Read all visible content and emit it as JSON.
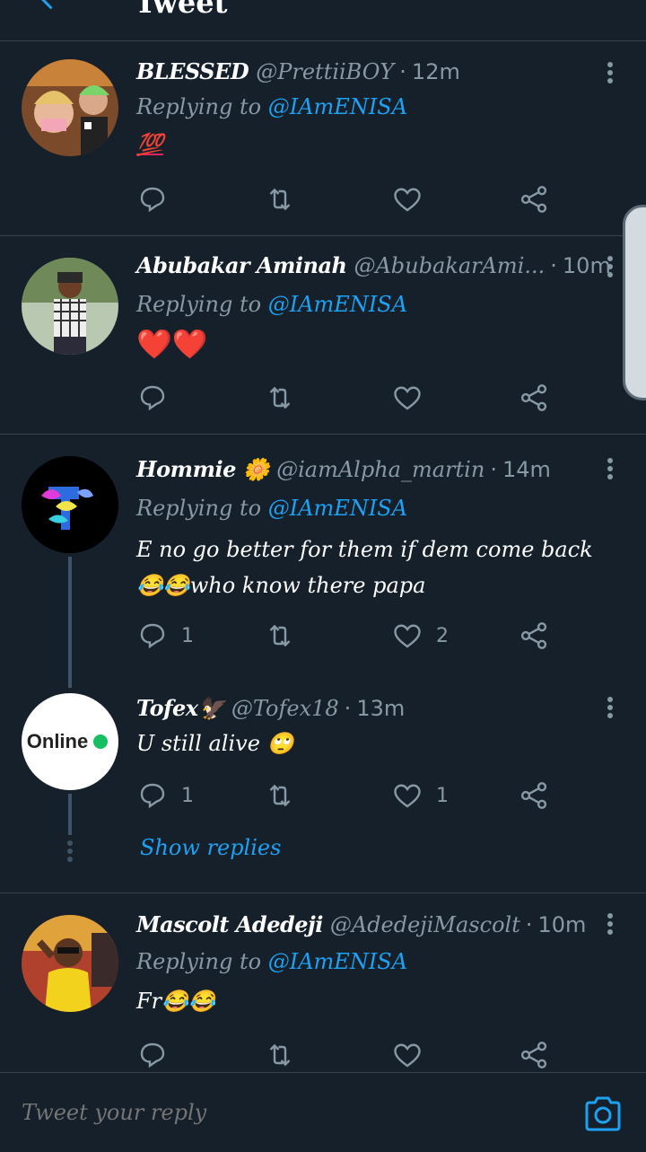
{
  "header": {
    "title": "Tweet"
  },
  "tweets": [
    {
      "name": "BLESSED",
      "handle": "@PrettiiBOY",
      "time": "12m",
      "reply_label": "Replying to",
      "reply_mention": "@IAmENISA",
      "text": "💯",
      "replies": "",
      "likes": ""
    },
    {
      "name": "Abubakar Aminah",
      "handle": "@AbubakarAmi...",
      "time": "10m",
      "reply_label": "Replying to",
      "reply_mention": "@IAmENISA",
      "text": "❤️❤️",
      "replies": "",
      "likes": ""
    },
    {
      "name": "Hommie 🌼",
      "handle": "@iamAlpha_martin",
      "time": "14m",
      "reply_label": "Replying to",
      "reply_mention": "@IAmENISA",
      "text": "E no go better for them if dem come back 😂😂who know there papa",
      "replies": "1",
      "likes": "2"
    },
    {
      "name": "Tofex🦅",
      "handle": "@Tofex18",
      "time": "13m",
      "text": "U still alive 🙄",
      "avatar_text": "Online",
      "replies": "1",
      "likes": "1"
    },
    {
      "name": "Mascolt Adedeji",
      "handle": "@AdedejiMascolt",
      "time": "10m",
      "reply_label": "Replying to",
      "reply_mention": "@IAmENISA",
      "text": "Fr😂😂",
      "replies": "",
      "likes": ""
    }
  ],
  "show_replies": "Show replies",
  "compose": {
    "placeholder": "Tweet your reply"
  },
  "icons": [
    "back-arrow-icon",
    "more-icon",
    "reply-icon",
    "retweet-icon",
    "like-icon",
    "share-icon",
    "camera-icon"
  ],
  "colors": {
    "background": "#15202b",
    "accent": "#1da1f2",
    "muted": "#8899a6",
    "divider": "#38444d"
  }
}
